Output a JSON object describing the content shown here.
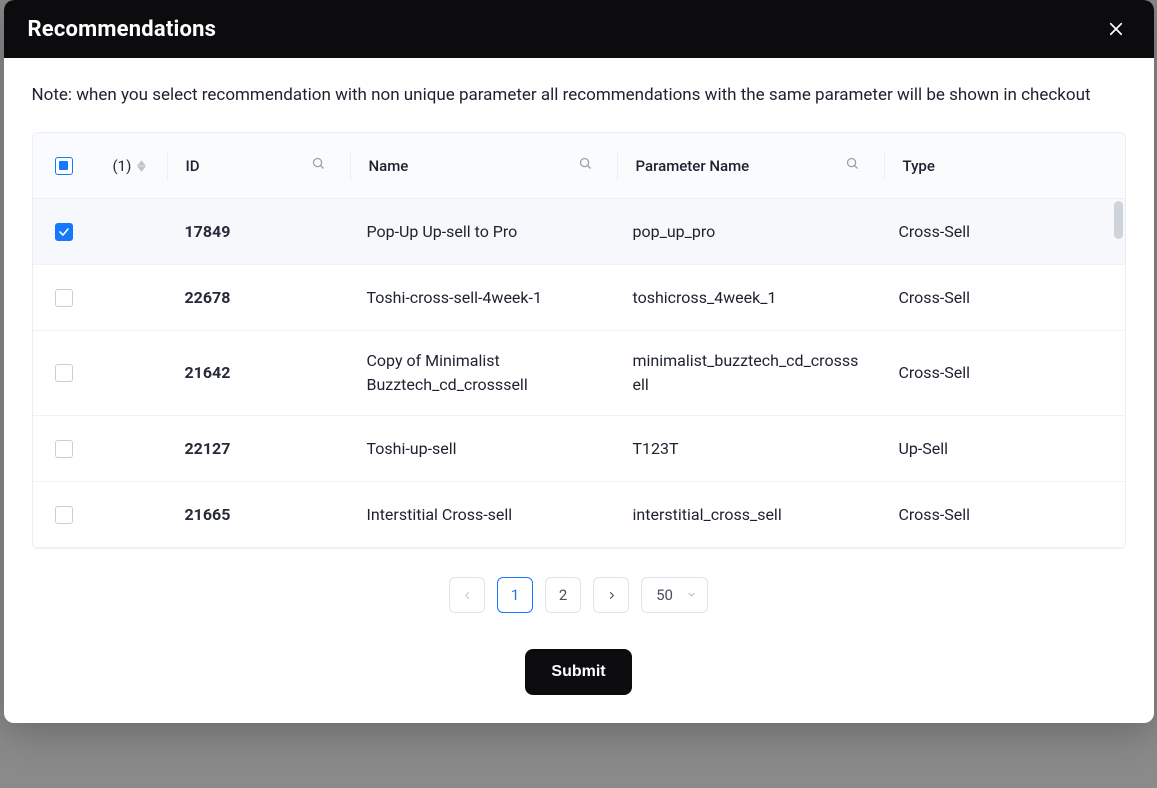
{
  "modal": {
    "title": "Recommendations",
    "note": "Note: when you select recommendation with non unique parameter all recommendations with the same parameter will be shown in checkout"
  },
  "table": {
    "selected_count_label": "(1)",
    "columns": {
      "id": "ID",
      "name": "Name",
      "parameter": "Parameter Name",
      "type": "Type"
    },
    "rows": [
      {
        "checked": true,
        "id": "17849",
        "name": "Pop-Up Up-sell to Pro",
        "param": "pop_up_pro",
        "type": "Cross-Sell"
      },
      {
        "checked": false,
        "id": "22678",
        "name": "Toshi-cross-sell-4week-1",
        "param": "toshicross_4week_1",
        "type": "Cross-Sell"
      },
      {
        "checked": false,
        "id": "21642",
        "name": "Copy of Minimalist Buzztech_cd_crosssell",
        "param": "minimalist_buzztech_cd_crosssell",
        "type": "Cross-Sell"
      },
      {
        "checked": false,
        "id": "22127",
        "name": "Toshi-up-sell",
        "param": "T123T",
        "type": "Up-Sell"
      },
      {
        "checked": false,
        "id": "21665",
        "name": "Interstitial Cross-sell",
        "param": "interstitial_cross_sell",
        "type": "Cross-Sell"
      }
    ]
  },
  "pagination": {
    "pages": [
      "1",
      "2"
    ],
    "active": "1",
    "page_size": "50"
  },
  "actions": {
    "submit": "Submit"
  }
}
